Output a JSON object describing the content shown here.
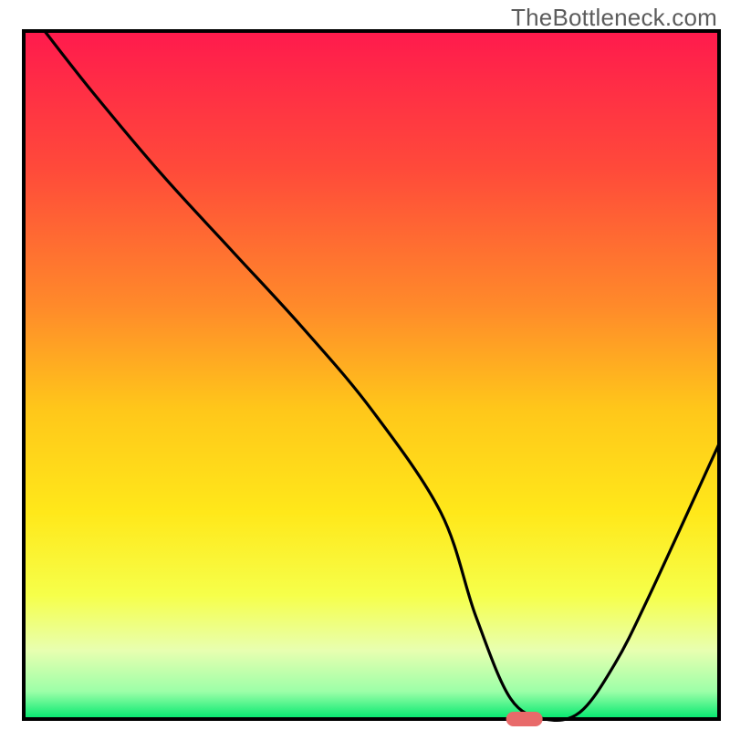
{
  "watermark": "TheBottleneck.com",
  "chart_data": {
    "type": "line",
    "title": "",
    "xlabel": "",
    "ylabel": "",
    "xlim": [
      0,
      100
    ],
    "ylim": [
      0,
      100
    ],
    "x": [
      3,
      10,
      20,
      30,
      40,
      50,
      60,
      65,
      70,
      75,
      80,
      85,
      90,
      100
    ],
    "values": [
      100,
      91,
      79,
      68,
      57,
      45,
      30,
      15,
      3,
      0,
      1,
      8,
      18,
      40
    ],
    "series_name": "bottleneck-curve",
    "marker": {
      "x": 72,
      "y": 0,
      "color": "#e86a6a"
    },
    "gradient_stops": [
      {
        "offset": 0.0,
        "color": "#ff1a4d"
      },
      {
        "offset": 0.2,
        "color": "#ff4a3a"
      },
      {
        "offset": 0.4,
        "color": "#ff8a2a"
      },
      {
        "offset": 0.55,
        "color": "#ffc71a"
      },
      {
        "offset": 0.7,
        "color": "#ffe81a"
      },
      {
        "offset": 0.82,
        "color": "#f6ff4a"
      },
      {
        "offset": 0.9,
        "color": "#e8ffb0"
      },
      {
        "offset": 0.96,
        "color": "#9cffa8"
      },
      {
        "offset": 1.0,
        "color": "#00e86e"
      }
    ],
    "axes": {
      "x_visible": true,
      "y_visible": false,
      "axis_color": "#000000",
      "axis_width": 4
    }
  }
}
